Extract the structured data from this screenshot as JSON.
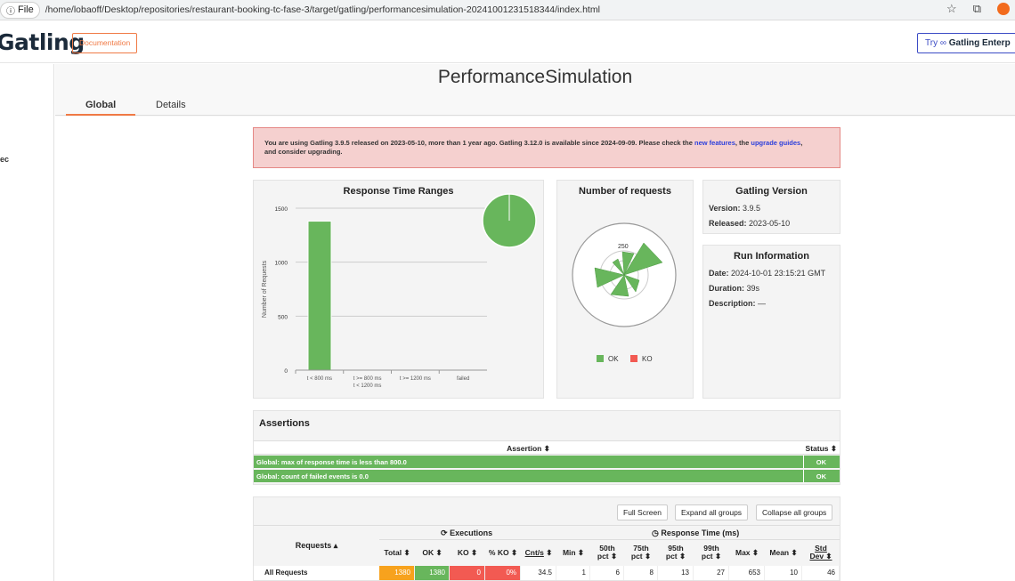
{
  "browser": {
    "scheme_label": "File",
    "url": "/home/lobaoff/Desktop/repositories/restaurant-booking-tc-fase-3/target/gatling/performancesimulation-20241001231518344/index.html"
  },
  "header": {
    "logo": "Gatling",
    "documentation": "Documentation",
    "try_prefix": "Try",
    "try_brand": "Gatling Enterp"
  },
  "sidebar": {
    "item": "ec"
  },
  "title": "PerformanceSimulation",
  "tabs": [
    {
      "label": "Global"
    },
    {
      "label": "Details"
    }
  ],
  "alert": {
    "text1": "You are using Gatling 3.9.5 released on 2023-05-10, more than 1 year ago. Gatling 3.12.0 is available since 2024-09-09. Please check the ",
    "link1": "new features",
    "text2": ", the ",
    "link2": "upgrade guides",
    "text3": ",",
    "text4": "and consider upgrading."
  },
  "response_time_ranges": {
    "title": "Response Time Ranges",
    "ylabel": "Number of Requests",
    "yticks": [
      "0",
      "500",
      "1000",
      "1500"
    ],
    "categories": [
      "t < 800 ms",
      "t >= 800 ms",
      "t >= 1200 ms",
      "failed"
    ],
    "category_line2": "t < 1200 ms"
  },
  "chart_data": [
    {
      "type": "bar",
      "title": "Response Time Ranges",
      "ylabel": "Number of Requests",
      "categories": [
        "t < 800 ms",
        "t >= 800 ms t < 1200 ms",
        "t >= 1200 ms",
        "failed"
      ],
      "values": [
        1380,
        0,
        0,
        0
      ],
      "ylim": [
        0,
        1500
      ],
      "colors": [
        "#68b65c"
      ]
    },
    {
      "type": "pie",
      "labels": [
        "t < 800 ms"
      ],
      "values": [
        1380
      ],
      "colors": [
        "#68b65c"
      ]
    }
  ],
  "number_of_requests": {
    "title": "Number of requests",
    "scale_label": "250",
    "legend": [
      {
        "label": "OK",
        "color": "#68b65c"
      },
      {
        "label": "KO",
        "color": "#f25a52"
      }
    ]
  },
  "gatling_version": {
    "title": "Gatling Version",
    "version_label": "Version:",
    "version": "3.9.5",
    "released_label": "Released:",
    "released": "2023-05-10"
  },
  "run_information": {
    "title": "Run Information",
    "date_label": "Date:",
    "date": "2024-10-01 23:15:21 GMT",
    "duration_label": "Duration:",
    "duration": "39s",
    "description_label": "Description:",
    "description": "—"
  },
  "assertions": {
    "title": "Assertions",
    "col_assertion": "Assertion ⬍",
    "col_status": "Status ⬍",
    "rows": [
      {
        "text": "Global: max of response time is less than 800.0",
        "status": "OK"
      },
      {
        "text": "Global: count of failed events is 0.0",
        "status": "OK"
      }
    ]
  },
  "stats": {
    "buttons": {
      "full_screen": "Full Screen",
      "expand": "Expand all groups",
      "collapse": "Collapse all groups"
    },
    "executions_label": "Executions",
    "response_time_label": "Response Time (ms)",
    "requests_header": "Requests ▴",
    "columns": {
      "total": "Total ⬍",
      "ok": "OK ⬍",
      "ko": "KO ⬍",
      "pko": "% KO ⬍",
      "cnts": "Cnt/s",
      "min": "Min ⬍",
      "p50a": "50th",
      "p50b": "pct ⬍",
      "p75a": "75th",
      "p75b": "pct ⬍",
      "p95a": "95th",
      "p95b": "pct ⬍",
      "p99a": "99th",
      "p99b": "pct ⬍",
      "max": "Max ⬍",
      "mean": "Mean ⬍",
      "stda": "Std",
      "stdb": "Dev ⬍",
      "sort": "⬍"
    },
    "row": {
      "label": "All Requests",
      "total": "1380",
      "ok": "1380",
      "ko": "0",
      "pko": "0%",
      "cnts": "34.5",
      "min": "1",
      "p50": "6",
      "p75": "8",
      "p95": "13",
      "p99": "27",
      "max": "653",
      "mean": "10",
      "std": "46"
    }
  }
}
